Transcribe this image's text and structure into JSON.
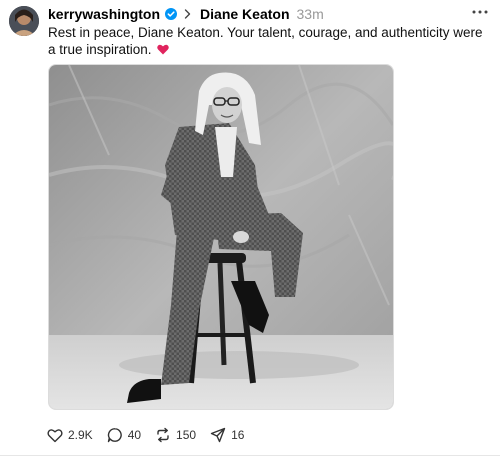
{
  "post": {
    "username": "kerrywashington",
    "topic": "Diane Keaton",
    "time": "33m",
    "caption": "Rest in peace, Diane Keaton. Your talent, courage, and authenticity were a true inspiration.",
    "caption_emoji": "red-heart-emoji",
    "image_description_icon": "photo",
    "stats": {
      "likes": "2.9K",
      "replies": "40",
      "reposts": "150",
      "shares": "16"
    }
  },
  "colors": {
    "verified_badge": "#0095f6",
    "muted_text": "#999999",
    "heart_emoji": "#e0245e"
  },
  "icons": {
    "verified": "verified-badge-icon",
    "chevron": "chevron-right-icon",
    "more": "more-horizontal-icon",
    "like": "heart-icon",
    "reply": "comment-icon",
    "repost": "repost-icon",
    "share": "send-icon"
  }
}
